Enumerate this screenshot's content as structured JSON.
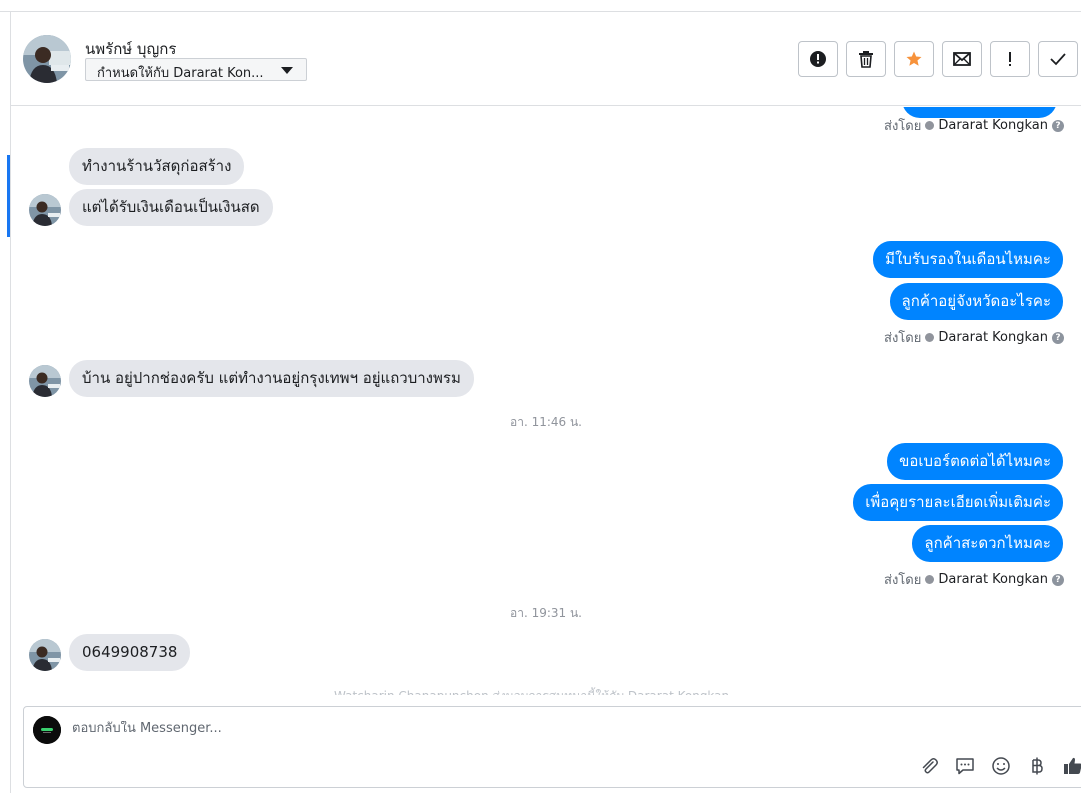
{
  "header": {
    "contact_name": "นพรักษ์ บุญกร",
    "assign_label": "กำหนดให้กับ Dararat Kon...",
    "actions": [
      {
        "name": "mark-spam-button",
        "icon": "alert-circle-icon"
      },
      {
        "name": "delete-button",
        "icon": "trash-icon"
      },
      {
        "name": "star-button",
        "icon": "star-icon"
      },
      {
        "name": "mark-unread-button",
        "icon": "envelope-icon"
      },
      {
        "name": "follow-up-button",
        "icon": "exclamation-icon"
      },
      {
        "name": "mark-done-button",
        "icon": "check-icon"
      }
    ]
  },
  "thread": {
    "sent_by_prefix": "ส่งโดย",
    "agent_name": "Dararat Kongkan",
    "incoming_1": [
      "ทำงานร้านวัสดุก่อสร้าง",
      "แต่ได้รับเงินเดือนเป็นเงินสด"
    ],
    "outgoing_1": [
      "มีใบรับรองในเดือนไหมคะ",
      "ลูกค้าอยู่จังหวัดอะไรคะ"
    ],
    "incoming_2": [
      "บ้าน อยู่ปากช่องครับ แต่ทำงานอยู่กรุงเทพฯ อยู่แถวบางพรม"
    ],
    "time_1": "อา. 11:46 น.",
    "outgoing_2": [
      "ขอเบอร์ตดต่อได้ไหมคะ",
      "เพื่อคุยรายละเอียดเพิ่มเติมค่ะ",
      "ลูกค้าสะดวกไหมคะ"
    ],
    "time_2": "อา. 19:31 น.",
    "incoming_3": [
      "0649908738"
    ],
    "system_note": "Watcharin Chanapunchon ส่งมอบการสนทนานี้ให้กับ Dararat Kongkan"
  },
  "composer": {
    "placeholder": "ตอบกลับใน Messenger...",
    "tools": [
      "paperclip-icon",
      "saved-reply-icon",
      "emoji-icon",
      "baht-icon",
      "like-icon"
    ]
  },
  "colors": {
    "outgoing_bubble": "#0084ff",
    "incoming_bubble": "#e4e6eb",
    "star": "#f7923b",
    "active_marker": "#1877f2"
  }
}
